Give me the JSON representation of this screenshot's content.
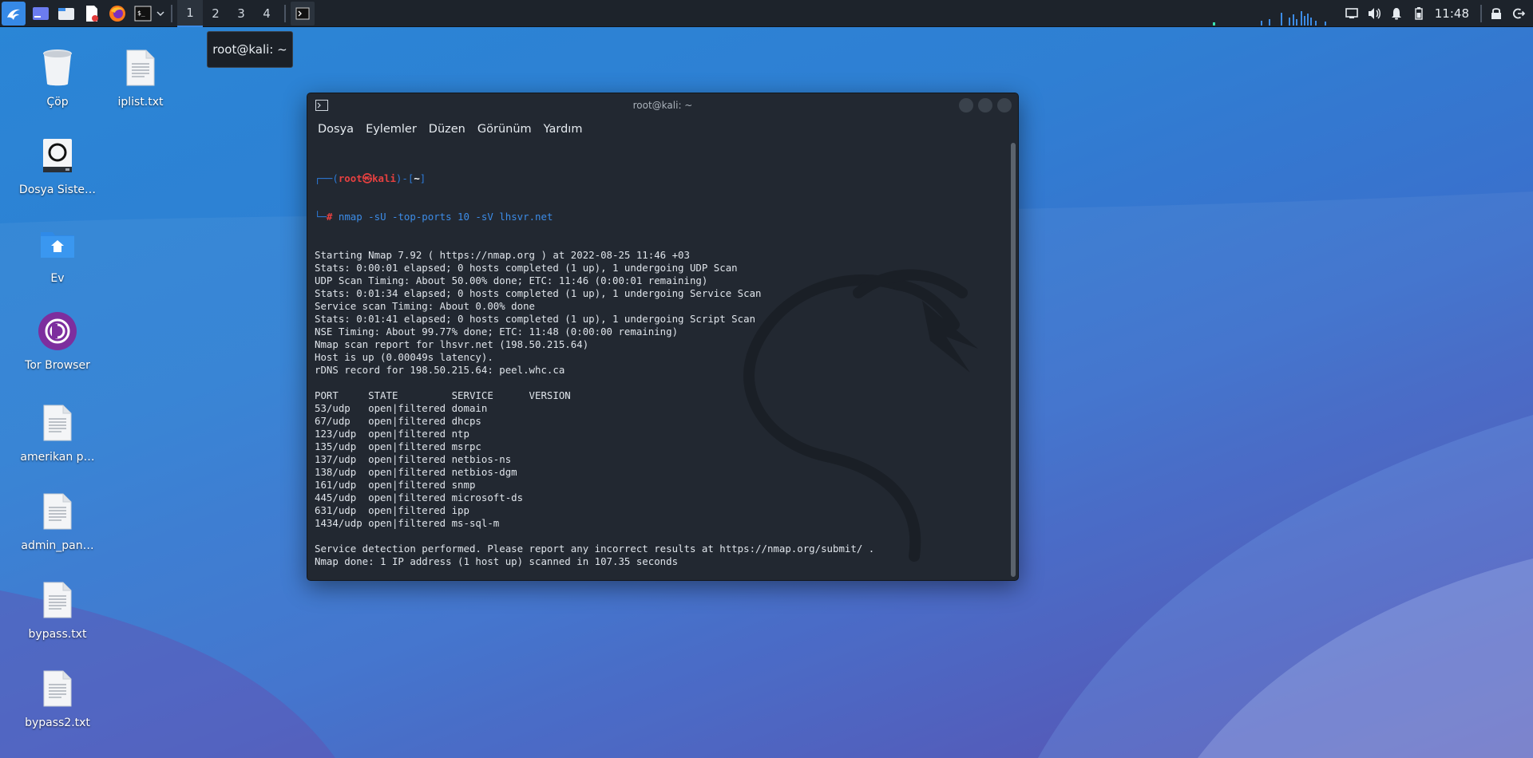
{
  "taskbar": {
    "workspaces": [
      "1",
      "2",
      "3",
      "4"
    ],
    "active_workspace": "1",
    "clock": "11:48",
    "launchers": [
      "kali-menu-icon",
      "desktop-icon",
      "file-manager-icon",
      "text-editor-icon",
      "firefox-icon",
      "terminal-icon"
    ],
    "tray": [
      "display-icon",
      "volume-icon",
      "notification-bell-icon",
      "battery-icon",
      "lock-icon",
      "power-icon"
    ]
  },
  "tooltip": {
    "text": "root@kali: ~"
  },
  "desktop": {
    "icons": [
      {
        "label": "Çöp",
        "icon": "trash-icon"
      },
      {
        "label": "iplist.txt",
        "icon": "text-file-icon"
      },
      {
        "label": "Dosya Siste…",
        "icon": "drive-icon"
      },
      {
        "label": "Ev",
        "icon": "home-folder-icon"
      },
      {
        "label": "Tor Browser",
        "icon": "tor-browser-icon"
      },
      {
        "label": "amerikan p…",
        "icon": "text-file-icon"
      },
      {
        "label": "admin_pan…",
        "icon": "text-file-icon"
      },
      {
        "label": "bypass.txt",
        "icon": "text-file-icon"
      },
      {
        "label": "bypass2.txt",
        "icon": "text-file-icon"
      }
    ]
  },
  "terminal": {
    "title": "root@kali: ~",
    "menu": [
      "Dosya",
      "Eylemler",
      "Düzen",
      "Görünüm",
      "Yardım"
    ],
    "prompt": {
      "open": "┌──(",
      "user": "root",
      "at": "㉿",
      "host": "kali",
      "mid": ")-[",
      "dir": "~",
      "close": "]",
      "second": "└─",
      "hash": "#"
    },
    "command": "nmap -sU -top-ports 10 -sV lhsvr.net",
    "output": [
      "Starting Nmap 7.92 ( https://nmap.org ) at 2022-08-25 11:46 +03",
      "Stats: 0:00:01 elapsed; 0 hosts completed (1 up), 1 undergoing UDP Scan",
      "UDP Scan Timing: About 50.00% done; ETC: 11:46 (0:00:01 remaining)",
      "Stats: 0:01:34 elapsed; 0 hosts completed (1 up), 1 undergoing Service Scan",
      "Service scan Timing: About 0.00% done",
      "Stats: 0:01:41 elapsed; 0 hosts completed (1 up), 1 undergoing Script Scan",
      "NSE Timing: About 99.77% done; ETC: 11:48 (0:00:00 remaining)",
      "Nmap scan report for lhsvr.net (198.50.215.64)",
      "Host is up (0.00049s latency).",
      "rDNS record for 198.50.215.64: peel.whc.ca",
      "",
      "PORT     STATE         SERVICE      VERSION",
      "53/udp   open|filtered domain",
      "67/udp   open|filtered dhcps",
      "123/udp  open|filtered ntp",
      "135/udp  open|filtered msrpc",
      "137/udp  open|filtered netbios-ns",
      "138/udp  open|filtered netbios-dgm",
      "161/udp  open|filtered snmp",
      "445/udp  open|filtered microsoft-ds",
      "631/udp  open|filtered ipp",
      "1434/udp open|filtered ms-sql-m",
      "",
      "Service detection performed. Please report any incorrect results at https://nmap.org/submit/ .",
      "Nmap done: 1 IP address (1 host up) scanned in 107.35 seconds",
      ""
    ]
  },
  "colors": {
    "taskbar": "#1d232b",
    "terminal_bg": "#222831",
    "accent": "#3c8ce7",
    "prompt_red": "#e64040"
  }
}
